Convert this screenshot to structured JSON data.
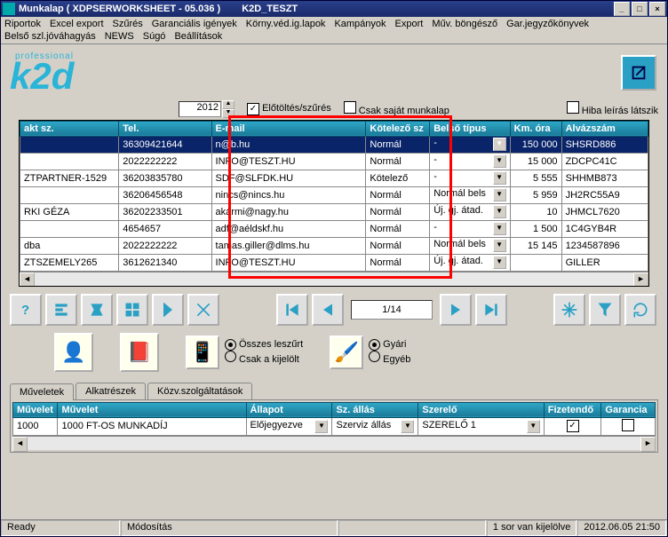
{
  "title": {
    "a": "Munkalap ( XDPSERWORKSHEET - 05.036 )",
    "b": "K2D_TESZT"
  },
  "menu": [
    "Riportok",
    "Excel export",
    "Szűrés",
    "Garanciális igények",
    "Körny.véd.ig.lapok",
    "Kampányok",
    "Export",
    "Műv. böngésző",
    "Gar.jegyzőkönyvek",
    "Belső szl.jóváhagyás",
    "NEWS",
    "Súgó",
    "Beállítások"
  ],
  "logo": {
    "small": "professional",
    "big": "k2d"
  },
  "year": "2012",
  "filters": {
    "elo": "Előtöltés/szűrés",
    "csak": "Csak saját munkalap",
    "hiba": "Hiba leírás látszik"
  },
  "cols": [
    "akt sz.",
    "Tel.",
    "E-mail",
    "Kötelező sz",
    "Belső típus",
    "Km. óra",
    "Alvázszám"
  ],
  "rows": [
    {
      "akt": "",
      "tel": "36309421644",
      "email": "n@b.hu",
      "kot": "Normál",
      "bt": "-",
      "km": "150 000",
      "alv": "SHSRD886"
    },
    {
      "akt": "",
      "tel": "2022222222",
      "email": "INFO@TESZT.HU",
      "kot": "Normál",
      "bt": "-",
      "km": "15 000",
      "alv": "ZDCPC41C"
    },
    {
      "akt": "ZTPARTNER-1529",
      "tel": "36203835780",
      "email": "SDF@SLFDK.HU",
      "kot": "Kötelező",
      "bt": "-",
      "km": "5 555",
      "alv": "SHHMB873"
    },
    {
      "akt": "",
      "tel": "36206456548",
      "email": "nincs@nincs.hu",
      "kot": "Normál",
      "bt": "Normál bels",
      "km": "5 959",
      "alv": "JH2RC55A9"
    },
    {
      "akt": "RKI GÉZA",
      "tel": "36202233501",
      "email": "akármi@nagy.hu",
      "kot": "Normál",
      "bt": "Új. gj. átad.",
      "km": "10",
      "alv": "JHMCL7620"
    },
    {
      "akt": "",
      "tel": "4654657",
      "email": "adf@aéldskf.hu",
      "kot": "Normál",
      "bt": "-",
      "km": "1 500",
      "alv": "1C4GYB4R"
    },
    {
      "akt": "dba",
      "tel": "2022222222",
      "email": "tamas.giller@dlms.hu",
      "kot": "Normál",
      "bt": "Normál bels",
      "km": "15 145",
      "alv": "1234587896"
    },
    {
      "akt": "ZTSZEMELY265",
      "tel": "3612621340",
      "email": "INFO@TESZT.HU",
      "kot": "Normál",
      "bt": "Új. gj. átad.",
      "km": "",
      "alv": "GILLER"
    }
  ],
  "pager": "1/14",
  "radios": {
    "osszes": "Összes leszűrt",
    "csakkij": "Csak a kijelölt",
    "gyari": "Gyári",
    "egyeb": "Egyéb"
  },
  "tabs": [
    "Műveletek",
    "Alkatrészek",
    "Közv.szolgáltatások"
  ],
  "detcols": [
    "Művelet",
    "Művelet",
    "Állapot",
    "Sz. állás",
    "Szerelő",
    "Fizetendő",
    "Garancia"
  ],
  "det": {
    "kod": "1000",
    "nev": "1000 FT-OS MUNKADÍJ",
    "allapot": "Előjegyezve",
    "szallas": "Szerviz állás",
    "szerelo": "SZERELŐ 1"
  },
  "status": {
    "ready": "Ready",
    "mod": "Módosítás",
    "sor": "1 sor van kijelölve",
    "ts": "2012.06.05 21:50"
  }
}
